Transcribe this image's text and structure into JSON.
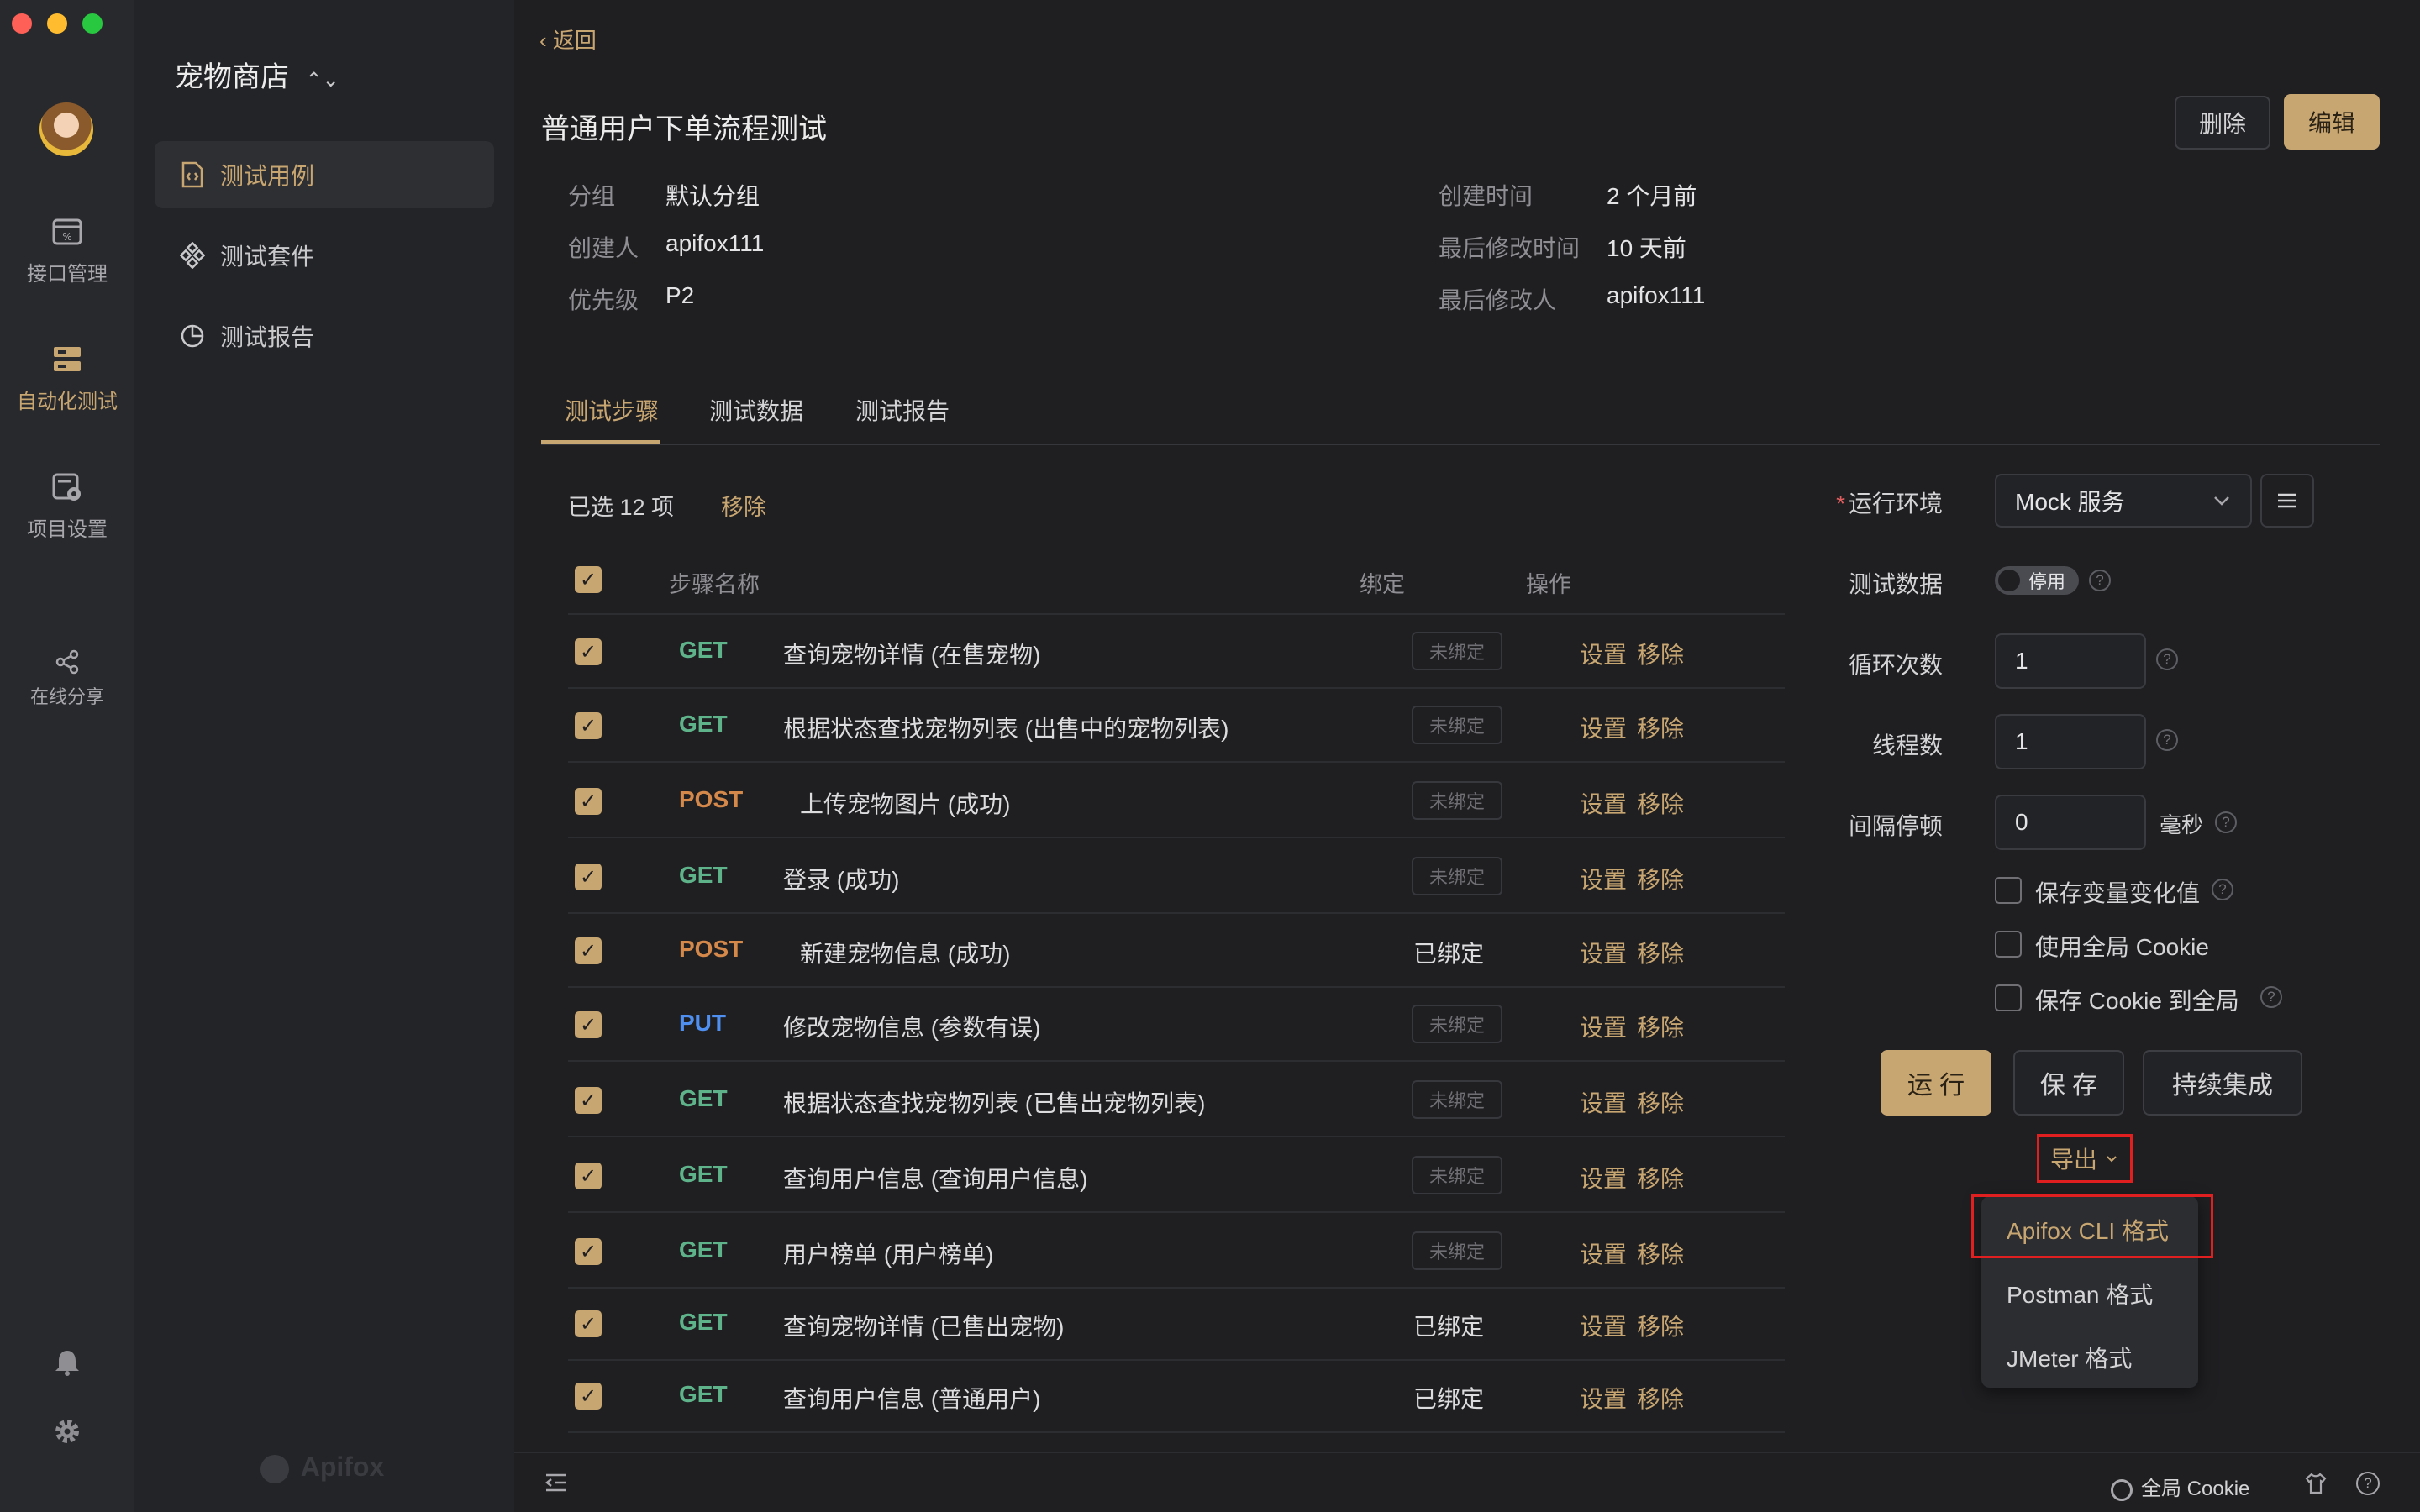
{
  "window": {
    "traffic_colors": [
      "#fe5f57",
      "#febc2e",
      "#28c840"
    ]
  },
  "rail": {
    "items": [
      {
        "label": "接口管理",
        "icon": "api-icon"
      },
      {
        "label": "自动化测试",
        "icon": "automation-icon"
      },
      {
        "label": "项目设置",
        "icon": "project-settings-icon"
      },
      {
        "label": "在线分享",
        "icon": "share-icon"
      }
    ]
  },
  "sidebar": {
    "project": "宠物商店",
    "items": [
      {
        "label": "测试用例",
        "icon": "test-case-icon"
      },
      {
        "label": "测试套件",
        "icon": "test-suite-icon"
      },
      {
        "label": "测试报告",
        "icon": "test-report-icon"
      }
    ],
    "watermark": "Apifox"
  },
  "header": {
    "back": "返回",
    "title": "普通用户下单流程测试",
    "delete": "删除",
    "edit": "编辑"
  },
  "meta": {
    "group_label": "分组",
    "group": "默认分组",
    "creator_label": "创建人",
    "creator": "apifox111",
    "priority_label": "优先级",
    "priority": "P2",
    "created_label": "创建时间",
    "created": "2 个月前",
    "modified_label": "最后修改时间",
    "modified": "10 天前",
    "modifier_label": "最后修改人",
    "modifier": "apifox111"
  },
  "tabs": [
    "测试步骤",
    "测试数据",
    "测试报告"
  ],
  "selection": {
    "count_text": "已选 12 项",
    "remove": "移除"
  },
  "table": {
    "headers": {
      "name": "步骤名称",
      "bind": "绑定",
      "ops": "操作"
    },
    "set_label": "设置",
    "remove_label": "移除",
    "unbound": "未绑定",
    "bound": "已绑定",
    "rows": [
      {
        "method": "GET",
        "name": "查询宠物详情 (在售宠物)",
        "bound": false
      },
      {
        "method": "GET",
        "name": "根据状态查找宠物列表 (出售中的宠物列表)",
        "bound": false
      },
      {
        "method": "POST",
        "name": "上传宠物图片 (成功)",
        "bound": false
      },
      {
        "method": "GET",
        "name": "登录 (成功)",
        "bound": false
      },
      {
        "method": "POST",
        "name": "新建宠物信息 (成功)",
        "bound": true
      },
      {
        "method": "PUT",
        "name": "修改宠物信息 (参数有误)",
        "bound": false
      },
      {
        "method": "GET",
        "name": "根据状态查找宠物列表 (已售出宠物列表)",
        "bound": false
      },
      {
        "method": "GET",
        "name": "查询用户信息 (查询用户信息)",
        "bound": false
      },
      {
        "method": "GET",
        "name": "用户榜单 (用户榜单)",
        "bound": false
      },
      {
        "method": "GET",
        "name": "查询宠物详情 (已售出宠物)",
        "bound": true
      },
      {
        "method": "GET",
        "name": "查询用户信息 (普通用户)",
        "bound": true
      }
    ]
  },
  "run_panel": {
    "env_label": "运行环境",
    "env_value": "Mock 服务",
    "test_data_label": "测试数据",
    "test_data_toggle": "停用",
    "loops_label": "循环次数",
    "loops": "1",
    "threads_label": "线程数",
    "threads": "1",
    "interval_label": "间隔停顿",
    "interval": "0",
    "interval_unit": "毫秒",
    "opt_save_vars": "保存变量变化值",
    "opt_global_cookie": "使用全局 Cookie",
    "opt_save_cookie": "保存 Cookie 到全局",
    "run": "运 行",
    "save": "保 存",
    "ci": "持续集成",
    "export": "导出",
    "export_options": [
      "Apifox CLI 格式",
      "Postman 格式",
      "JMeter 格式"
    ]
  },
  "footer": {
    "cookie": "全局 Cookie"
  },
  "colors": {
    "accent": "#c8a671",
    "get": "#5fb38a",
    "post": "#d4884a",
    "put": "#4f8ff0",
    "highlight_box": "#e02020"
  }
}
